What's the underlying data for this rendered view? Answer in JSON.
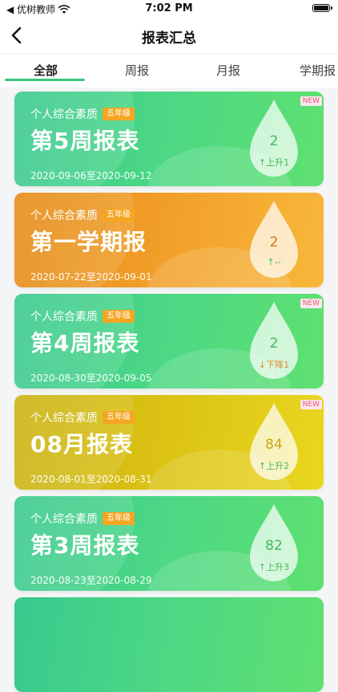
{
  "status_bar": {
    "back_app": "◀ 优树教师",
    "time": "7:02 PM"
  },
  "nav": {
    "title": "报表汇总"
  },
  "tabs": [
    {
      "label": "全部"
    },
    {
      "label": "周报"
    },
    {
      "label": "月报"
    },
    {
      "label": "学期报"
    }
  ],
  "colors": {
    "accent": "#39c680",
    "up": "#44b85b",
    "down": "#e98a34"
  },
  "cards": [
    {
      "subtitle": "个人综合素质",
      "grade": "五年级",
      "title": "第5周报表",
      "date": "2020-09-06至2020-09-12",
      "value": "2",
      "change": "↑上升1",
      "is_new": "NEW"
    },
    {
      "subtitle": "个人综合素质",
      "grade": "五年级",
      "title": "第一学期报",
      "date": "2020-07-22至2020-09-01",
      "value": "2",
      "change": "↑--",
      "is_new": ""
    },
    {
      "subtitle": "个人综合素质",
      "grade": "五年级",
      "title": "第4周报表",
      "date": "2020-08-30至2020-09-05",
      "value": "2",
      "change": "↓下降1",
      "is_new": "NEW"
    },
    {
      "subtitle": "个人综合素质",
      "grade": "五年级",
      "title": "08月报表",
      "date": "2020-08-01至2020-08-31",
      "value": "84",
      "change": "↑上升2",
      "is_new": "NEW"
    },
    {
      "subtitle": "个人综合素质",
      "grade": "五年级",
      "title": "第3周报表",
      "date": "2020-08-23至2020-08-29",
      "value": "82",
      "change": "↑上升3",
      "is_new": ""
    }
  ]
}
